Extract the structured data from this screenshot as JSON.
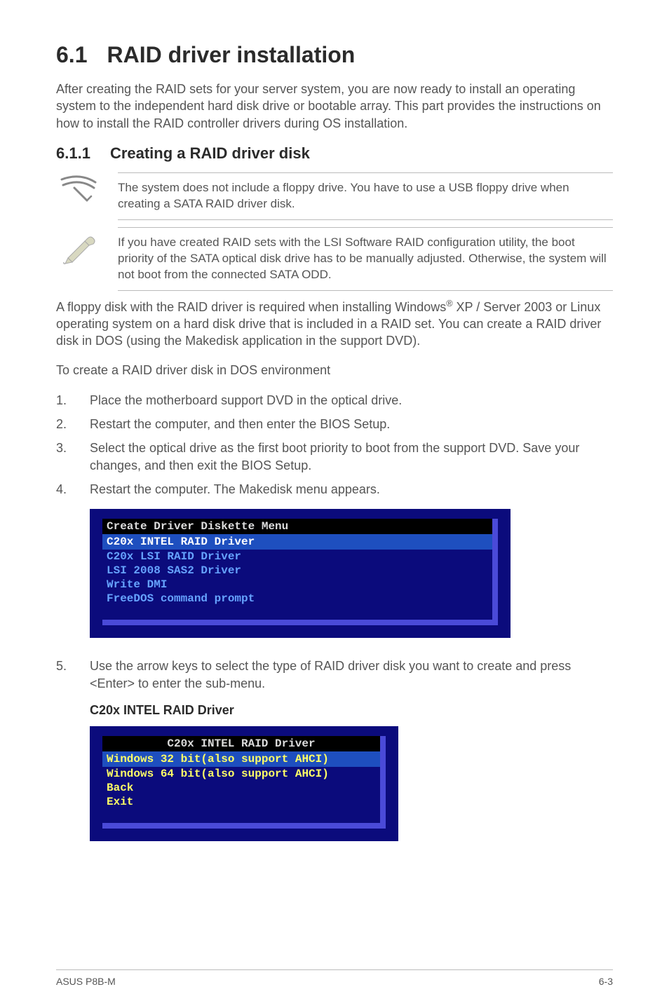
{
  "heading": {
    "number": "6.1",
    "title": "RAID driver installation"
  },
  "intro": "After creating the RAID sets for your server system, you are now ready to install an operating system to the independent hard disk drive or bootable array. This part provides the instructions on how to install the RAID controller drivers during OS installation.",
  "subheading": {
    "number": "6.1.1",
    "title": "Creating a RAID driver disk"
  },
  "note1": "The system does not include a floppy drive. You have to use a USB floppy drive when creating a SATA RAID driver disk.",
  "note2": "If you have created RAID sets with the LSI Software RAID configuration utility, the boot priority of the SATA optical disk drive has to be manually adjusted. Otherwise, the system will not boot from the connected SATA ODD.",
  "para2a": "A floppy disk with the RAID driver is required when installing Windows",
  "para2b": " XP / Server 2003 or Linux operating system on a hard disk drive that is included in a RAID set. You can create a RAID driver disk in DOS (using the Makedisk application in the support DVD).",
  "para3": "To create a RAID driver disk in DOS environment",
  "steps": [
    "Place the motherboard support DVD in the optical drive.",
    "Restart the computer, and then enter the BIOS Setup.",
    "Select the optical drive as the first boot priority to boot from the support DVD. Save your changes, and then exit the BIOS Setup.",
    "Restart the computer. The Makedisk menu appears."
  ],
  "menu1": {
    "title": "Create Driver Diskette Menu",
    "selected": "C20x INTEL RAID Driver",
    "items": [
      "C20x LSI RAID Driver",
      "LSI 2008 SAS2 Driver",
      "Write DMI",
      "FreeDOS command prompt"
    ]
  },
  "step5": "Use the arrow keys to select the type of RAID driver disk you want to create and press <Enter> to enter the sub-menu.",
  "sub2": "C20x INTEL RAID Driver",
  "menu2": {
    "title": "C20x INTEL RAID Driver",
    "selected": "Windows 32 bit(also support AHCI)",
    "items": [
      "Windows 64 bit(also support AHCI)",
      "Back",
      "Exit"
    ]
  },
  "footer": {
    "left": "ASUS P8B-M",
    "right": "6-3"
  }
}
